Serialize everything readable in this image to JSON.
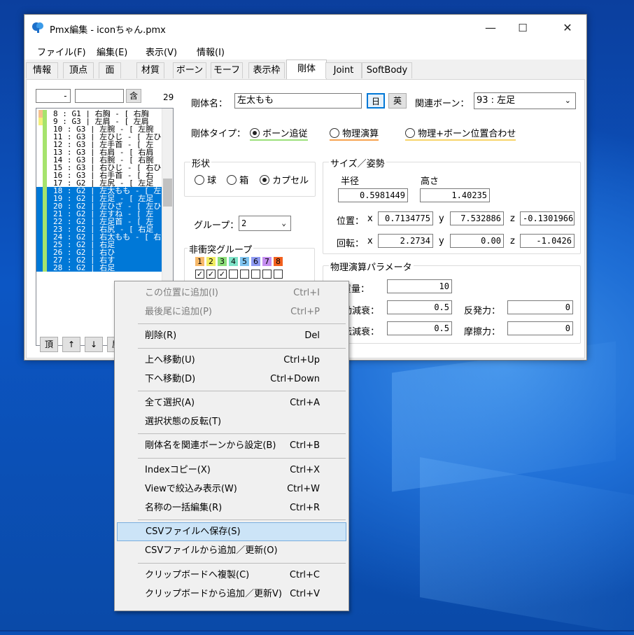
{
  "window": {
    "title": "Pmx編集 - iconちゃん.pmx",
    "min": "—",
    "max": "☐",
    "close": "✕"
  },
  "menubar": [
    "ファイル(F)",
    "編集(E)",
    "表示(V)",
    "情報(I)"
  ],
  "tabs": [
    "情報",
    "頂点",
    "面",
    "材質",
    "ボーン",
    "モーフ",
    "表示枠",
    "剛体",
    "Joint",
    "SoftBody"
  ],
  "list": {
    "filter_value": "-",
    "filter_button": "含",
    "count": "29",
    "rows": [
      {
        "text": "8 : G1 | 右胸  - [ 右胸",
        "sel": false,
        "c1": "#f5c08c",
        "c2": "#a6e36d"
      },
      {
        "text": "9 : G3 | 左肩  - [ 左肩",
        "sel": false,
        "c1": "#f4f07a",
        "c2": "#a6e36d"
      },
      {
        "text": "10 : G3 | 左腕  - [ 左腕",
        "sel": false,
        "c1": "",
        "c2": "#a6e36d"
      },
      {
        "text": "11 : G3 | 左ひじ - [ 左ひ",
        "sel": false,
        "c1": "",
        "c2": "#a6e36d"
      },
      {
        "text": "12 : G3 | 左手首 - [ 左",
        "sel": false,
        "c1": "",
        "c2": "#a6e36d"
      },
      {
        "text": "13 : G3 | 右肩  - [ 右肩",
        "sel": false,
        "c1": "",
        "c2": "#a6e36d"
      },
      {
        "text": "14 : G3 | 右腕  - [ 右腕",
        "sel": false,
        "c1": "",
        "c2": "#a6e36d"
      },
      {
        "text": "15 : G3 | 右ひじ - [ 右ひ",
        "sel": false,
        "c1": "",
        "c2": "#a6e36d"
      },
      {
        "text": "16 : G3 | 右手首 - [ 右",
        "sel": false,
        "c1": "",
        "c2": "#a6e36d"
      },
      {
        "text": "17 : G2 | 左尻  - [ 左足",
        "sel": false,
        "c1": "",
        "c2": "#a6e36d"
      },
      {
        "text": "18 : G2 | 左太もも - [ 左",
        "sel": true,
        "c1": "",
        "c2": "#a6e36d"
      },
      {
        "text": "19 : G2 | 左足  - [ 左足",
        "sel": true,
        "c1": "",
        "c2": "#a6e36d"
      },
      {
        "text": "20 : G2 | 左ひざ - [ 左ひ",
        "sel": true,
        "c1": "",
        "c2": "#a6e36d"
      },
      {
        "text": "21 : G2 | 左すね - [ 左",
        "sel": true,
        "c1": "",
        "c2": "#a6e36d"
      },
      {
        "text": "22 : G2 | 左足首 - [ 左",
        "sel": true,
        "c1": "",
        "c2": "#a6e36d"
      },
      {
        "text": "23 : G2 | 右尻  - [ 右足",
        "sel": true,
        "c1": "",
        "c2": "#a6e36d"
      },
      {
        "text": "24 : G2 | 右太もも - [ 右",
        "sel": true,
        "c1": "",
        "c2": "#a6e36d"
      },
      {
        "text": "25 : G2 | 右足",
        "sel": true,
        "c1": "",
        "c2": "#a6e36d"
      },
      {
        "text": "26 : G2 | 右ひ",
        "sel": true,
        "c1": "",
        "c2": "#a6e36d"
      },
      {
        "text": "27 : G2 | 右す",
        "sel": true,
        "c1": "",
        "c2": "#a6e36d"
      },
      {
        "text": "28 : G2 | 右足",
        "sel": true,
        "c1": "",
        "c2": "#a6e36d"
      }
    ],
    "nav_buttons": [
      "頂",
      "↑",
      "↓",
      "尻"
    ]
  },
  "body": {
    "name_label": "剛体名：",
    "name_value": "左太もも",
    "jp_button": "日",
    "en_button": "英",
    "related_bone_label": "関連ボーン：",
    "related_bone_value": "93 : 左足",
    "type_label": "剛体タイプ：",
    "type_options": [
      "ボーン追従",
      "物理演算",
      "物理+ボーン位置合わせ"
    ],
    "type_selected": 0,
    "shape_title": "形状",
    "shape_options": [
      "球",
      "箱",
      "カプセル"
    ],
    "shape_selected": 2,
    "group_label": "グループ：",
    "group_value": "2",
    "nocollide_title": "非衝突グループ",
    "nocollide_numbers": [
      "1",
      "2",
      "3",
      "4",
      "5",
      "6",
      "7",
      "8"
    ],
    "nocollide_colors": [
      "#f7b96a",
      "#f2ee63",
      "#8ee07a",
      "#7fe3c8",
      "#7fc4f0",
      "#8e9af2",
      "#c58ef0",
      "#f2601e"
    ],
    "nocollide_checked": [
      true,
      true,
      true,
      false,
      false,
      false,
      false,
      false
    ],
    "size_title": "サイズ／姿勢",
    "radius_label": "半径",
    "radius_value": "0.5981449",
    "height_label": "高さ",
    "height_value": "1.40235",
    "pos_label": "位置：",
    "pos": {
      "x": "0.7134775",
      "y": "7.532886",
      "z": "-0.1301966"
    },
    "rot_label": "回転：",
    "rot": {
      "x": "2.2734",
      "y": "0.00",
      "z": "-1.0426"
    },
    "axis": {
      "x": "x",
      "y": "y",
      "z": "z"
    },
    "phys_title": "物理演算パラメータ",
    "mass_label": "質量：",
    "mass_value": "10",
    "move_damp_label": "移動減衰：",
    "move_damp_value": "0.5",
    "rot_damp_label": "回転減衰：",
    "rot_damp_value": "0.5",
    "restitution_label": "反発力：",
    "restitution_value": "0",
    "friction_label": "摩擦力：",
    "friction_value": "0"
  },
  "context_menu": [
    {
      "label": "この位置に追加(I)",
      "key": "Ctrl+I",
      "disabled": true
    },
    {
      "label": "最後尾に追加(P)",
      "key": "Ctrl+P",
      "disabled": true
    },
    {
      "sep": true
    },
    {
      "label": "削除(R)",
      "key": "Del"
    },
    {
      "sep": true
    },
    {
      "label": "上へ移動(U)",
      "key": "Ctrl+Up"
    },
    {
      "label": "下へ移動(D)",
      "key": "Ctrl+Down"
    },
    {
      "sep": true
    },
    {
      "label": "全て選択(A)",
      "key": "Ctrl+A"
    },
    {
      "label": "選択状態の反転(T)",
      "key": ""
    },
    {
      "sep": true
    },
    {
      "label": "剛体名を関連ボーンから設定(B)",
      "key": "Ctrl+B"
    },
    {
      "sep": true
    },
    {
      "label": "Indexコピー(X)",
      "key": "Ctrl+X"
    },
    {
      "label": "Viewで絞込み表示(W)",
      "key": "Ctrl+W"
    },
    {
      "label": "名称の一括編集(R)",
      "key": "Ctrl+R"
    },
    {
      "sep": true
    },
    {
      "label": "CSVファイルへ保存(S)",
      "key": "",
      "highlight": true
    },
    {
      "label": "CSVファイルから追加／更新(O)",
      "key": ""
    },
    {
      "sep": true
    },
    {
      "label": "クリップボードへ複製(C)",
      "key": "Ctrl+C"
    },
    {
      "label": "クリップボードから追加／更新V)",
      "key": "Ctrl+V"
    }
  ]
}
